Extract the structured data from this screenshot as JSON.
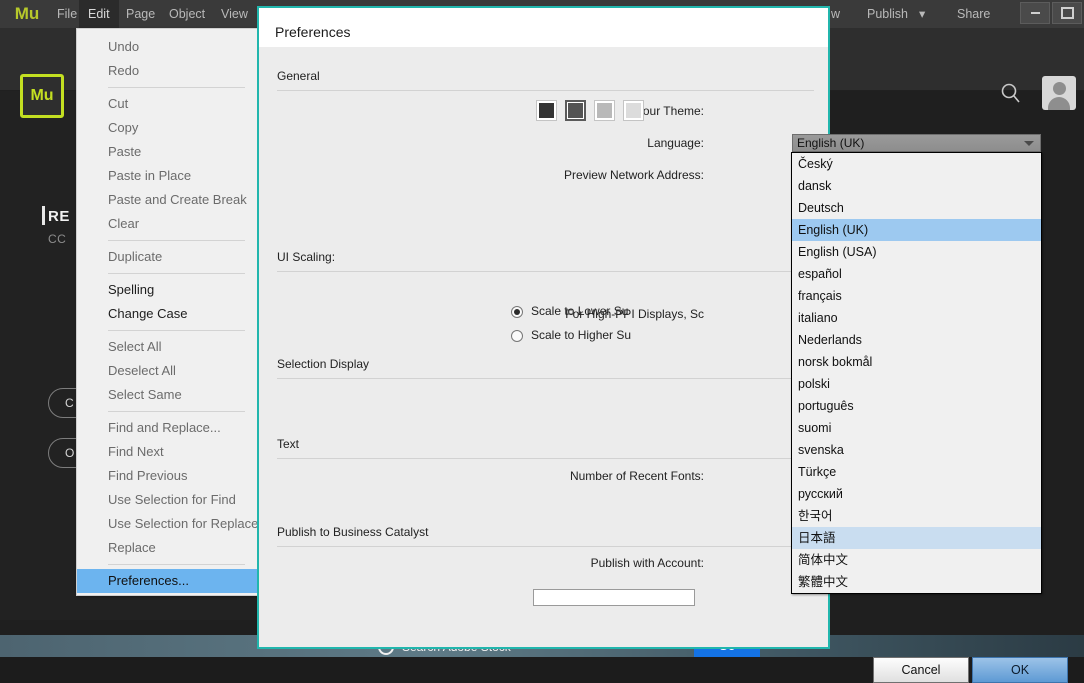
{
  "app": {
    "wordmark": "Mu",
    "logo_text": "Mu",
    "logo_color": "#c3df21",
    "menubar": [
      {
        "label": "File",
        "active": false
      },
      {
        "label": "Edit",
        "active": true
      },
      {
        "label": "Page",
        "active": false
      },
      {
        "label": "Object",
        "active": false
      },
      {
        "label": "View",
        "active": false
      },
      {
        "label": "w",
        "active": false
      },
      {
        "label": "Publish",
        "active": false
      },
      {
        "label": "Share",
        "active": false
      }
    ],
    "publish_caret": "▾",
    "window_controls": [
      "minimize",
      "maximize"
    ],
    "search_icon": "search-icon",
    "avatar": "user-avatar"
  },
  "welcome": {
    "title": "RE",
    "subtitle": "CC",
    "button_one": "C",
    "button_two": "O"
  },
  "stock": {
    "placeholder": "Search Adobe Stock",
    "go_label": "Go",
    "accent": "#1473e6"
  },
  "edit_menu": {
    "items": [
      {
        "label": "Undo",
        "enabled": false,
        "selected": false,
        "sep_after": false
      },
      {
        "label": "Redo",
        "enabled": false,
        "selected": false,
        "sep_after": true
      },
      {
        "label": "Cut",
        "enabled": false,
        "selected": false,
        "sep_after": false
      },
      {
        "label": "Copy",
        "enabled": false,
        "selected": false,
        "sep_after": false
      },
      {
        "label": "Paste",
        "enabled": false,
        "selected": false,
        "sep_after": false
      },
      {
        "label": "Paste in Place",
        "enabled": false,
        "selected": false,
        "sep_after": false
      },
      {
        "label": "Paste and Create Break",
        "enabled": false,
        "selected": false,
        "sep_after": false
      },
      {
        "label": "Clear",
        "enabled": false,
        "selected": false,
        "sep_after": true
      },
      {
        "label": "Duplicate",
        "enabled": false,
        "selected": false,
        "sep_after": true
      },
      {
        "label": "Spelling",
        "enabled": true,
        "selected": false,
        "sep_after": false
      },
      {
        "label": "Change Case",
        "enabled": true,
        "selected": false,
        "sep_after": true
      },
      {
        "label": "Select All",
        "enabled": false,
        "selected": false,
        "sep_after": false
      },
      {
        "label": "Deselect All",
        "enabled": false,
        "selected": false,
        "sep_after": false
      },
      {
        "label": "Select Same",
        "enabled": false,
        "selected": false,
        "sep_after": true
      },
      {
        "label": "Find and Replace...",
        "enabled": false,
        "selected": false,
        "sep_after": false
      },
      {
        "label": "Find Next",
        "enabled": false,
        "selected": false,
        "sep_after": false
      },
      {
        "label": "Find Previous",
        "enabled": false,
        "selected": false,
        "sep_after": false
      },
      {
        "label": "Use Selection for Find",
        "enabled": false,
        "selected": false,
        "sep_after": false
      },
      {
        "label": "Use Selection for Replace",
        "enabled": false,
        "selected": false,
        "sep_after": false
      },
      {
        "label": "Replace",
        "enabled": false,
        "selected": false,
        "sep_after": true
      },
      {
        "label": "Preferences...",
        "enabled": true,
        "selected": true,
        "sep_after": false
      }
    ]
  },
  "prefs": {
    "title": "Preferences",
    "accent": "#21b6ad",
    "sections": {
      "general": "General",
      "ui_scaling": "UI Scaling:",
      "selection_display": "Selection Display",
      "text": "Text",
      "publish_bc": "Publish to Business Catalyst"
    },
    "labels": {
      "colour_theme": "Colour Theme:",
      "language": "Language:",
      "preview_network_address": "Preview Network Address:",
      "high_ppi": "For High-PPI Displays, Sc",
      "recent_fonts": "Number of Recent Fonts:",
      "publish_with_account": "Publish with Account:"
    },
    "colour_theme": {
      "swatches": [
        "#333333",
        "#535353",
        "#b9b9b9",
        "#dcdcdc"
      ],
      "selected_index": 1
    },
    "language": {
      "value": "English (UK)",
      "options": [
        {
          "label": "Český",
          "state": "normal"
        },
        {
          "label": "dansk",
          "state": "normal"
        },
        {
          "label": "Deutsch",
          "state": "normal"
        },
        {
          "label": "English (UK)",
          "state": "selected"
        },
        {
          "label": "English (USA)",
          "state": "normal"
        },
        {
          "label": "español",
          "state": "normal"
        },
        {
          "label": "français",
          "state": "normal"
        },
        {
          "label": "italiano",
          "state": "normal"
        },
        {
          "label": "Nederlands",
          "state": "normal"
        },
        {
          "label": "norsk bokmål",
          "state": "normal"
        },
        {
          "label": "polski",
          "state": "normal"
        },
        {
          "label": "português",
          "state": "normal"
        },
        {
          "label": "suomi",
          "state": "normal"
        },
        {
          "label": "svenska",
          "state": "normal"
        },
        {
          "label": "Türkçe",
          "state": "normal"
        },
        {
          "label": "русский",
          "state": "normal"
        },
        {
          "label": "한국어",
          "state": "normal"
        },
        {
          "label": "日本語",
          "state": "hover"
        },
        {
          "label": "简体中文",
          "state": "normal"
        },
        {
          "label": "繁體中文",
          "state": "normal"
        }
      ]
    },
    "ui_scaling": {
      "radio_lower": "Scale to Lower Su",
      "radio_higher": "Scale to Higher Su",
      "selected": "lower"
    },
    "buttons": {
      "cancel": "Cancel",
      "ok": "OK"
    }
  }
}
